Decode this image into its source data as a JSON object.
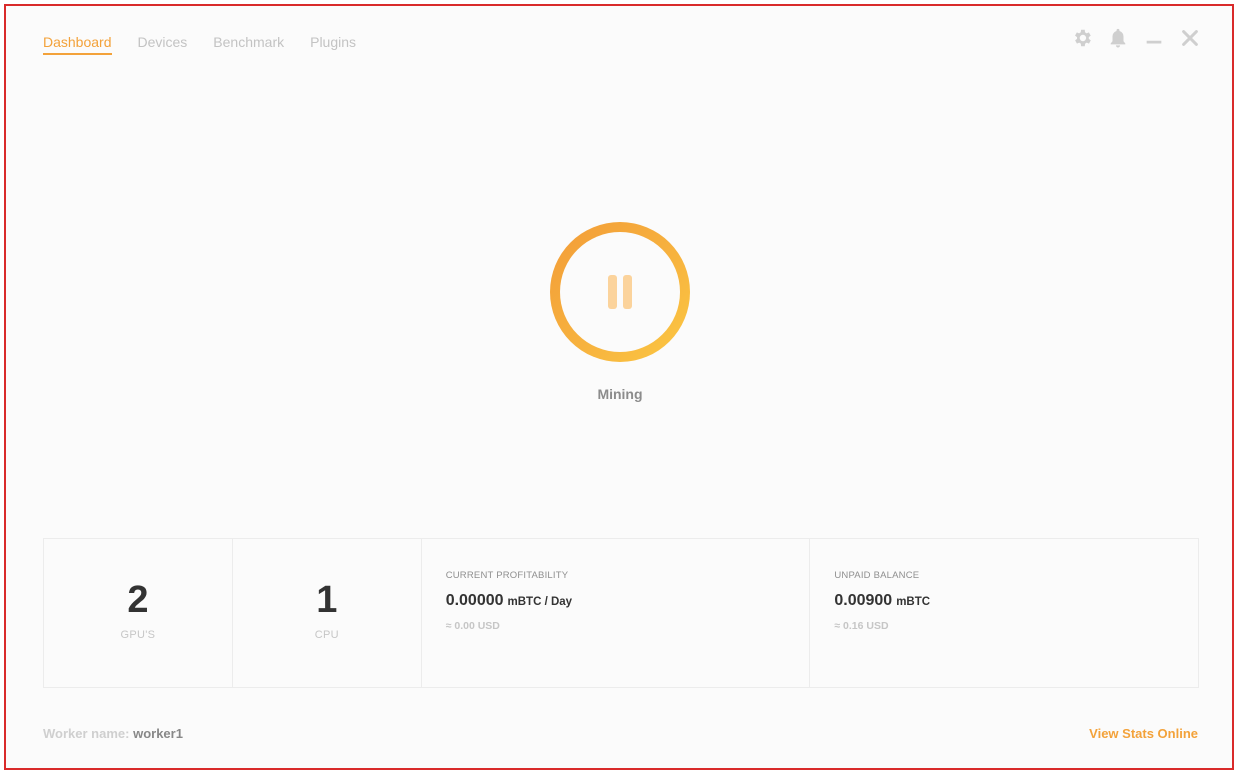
{
  "nav": {
    "tabs": [
      {
        "label": "Dashboard",
        "active": true
      },
      {
        "label": "Devices",
        "active": false
      },
      {
        "label": "Benchmark",
        "active": false
      },
      {
        "label": "Plugins",
        "active": false
      }
    ]
  },
  "window_controls": {
    "icons": [
      "gear-icon",
      "bell-icon",
      "minimize-icon",
      "close-icon"
    ]
  },
  "mining": {
    "status_label": "Mining",
    "button_icon": "pause-icon"
  },
  "stats": {
    "gpus": {
      "value": "2",
      "caption": "GPU'S"
    },
    "cpus": {
      "value": "1",
      "caption": "CPU"
    },
    "profitability": {
      "title": "CURRENT PROFITABILITY",
      "value": "0.00000",
      "unit": "mBTC / Day",
      "usd": "≈ 0.00 USD"
    },
    "balance": {
      "title": "UNPAID BALANCE",
      "value": "0.00900",
      "unit": "mBTC",
      "usd": "≈ 0.16 USD"
    }
  },
  "footer": {
    "worker_label": "Worker name:",
    "worker_name": "worker1",
    "view_stats_label": "View Stats Online"
  },
  "colors": {
    "accent": "#f3a23a",
    "frame": "#d92a2a",
    "text_dark": "#333333",
    "text_muted": "#c3c3c3"
  }
}
